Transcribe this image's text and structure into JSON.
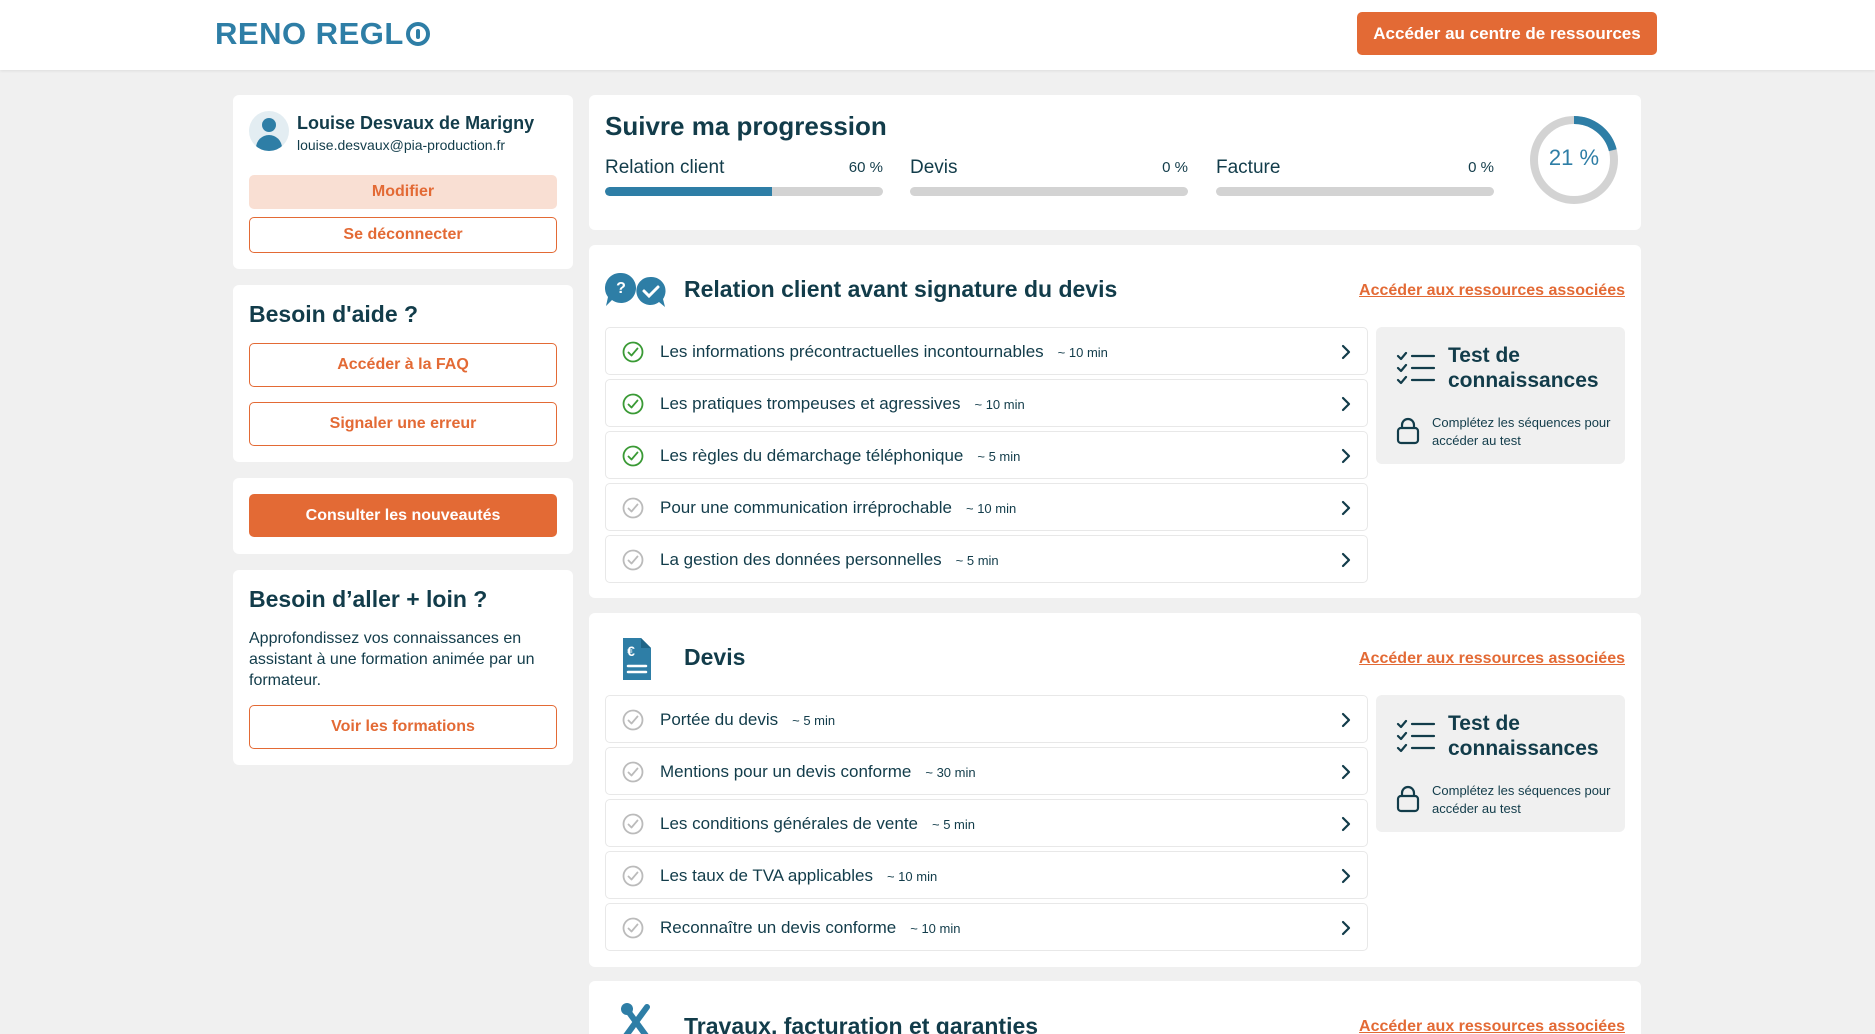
{
  "header": {
    "logo": "RENO REGL",
    "resources_button": "Accéder au centre de ressources"
  },
  "profile": {
    "name": "Louise Desvaux de Marigny",
    "email": "louise.desvaux@pia-production.fr",
    "edit_button": "Modifier",
    "logout_button": "Se déconnecter"
  },
  "help": {
    "title": "Besoin d'aide ?",
    "faq_button": "Accéder à la FAQ",
    "report_button": "Signaler une erreur"
  },
  "news": {
    "button": "Consulter les nouveautés"
  },
  "more": {
    "title": "Besoin d’aller + loin ?",
    "text": "Approfondissez vos connaissances en assistant à une formation animée par un formateur.",
    "button": "Voir les formations"
  },
  "progress": {
    "title": "Suivre ma progression",
    "items": [
      {
        "label": "Relation client",
        "pct_label": "60 %",
        "value": 0.6
      },
      {
        "label": "Devis",
        "pct_label": "0 %",
        "value": 0
      },
      {
        "label": "Facture",
        "pct_label": "0 %",
        "value": 0
      }
    ],
    "overall_label": "21 %",
    "overall_value": 0.21
  },
  "sections": [
    {
      "title": "Relation client avant signature du devis",
      "link": "Accéder aux ressources associées",
      "modules": [
        {
          "title": "Les informations précontractuelles incontournables",
          "duration": "~ 10 min",
          "done": true
        },
        {
          "title": "Les pratiques trompeuses et agressives",
          "duration": "~ 10 min",
          "done": true
        },
        {
          "title": "Les règles du démarchage téléphonique",
          "duration": "~ 5 min",
          "done": true
        },
        {
          "title": "Pour une communication irréprochable",
          "duration": "~ 10 min",
          "done": false
        },
        {
          "title": "La gestion des données personnelles",
          "duration": "~ 5 min",
          "done": false
        }
      ],
      "test_title": "Test de connaissances",
      "test_note": "Complétez les séquences pour accéder au test"
    },
    {
      "title": "Devis",
      "link": "Accéder aux ressources associées",
      "modules": [
        {
          "title": "Portée du devis",
          "duration": "~ 5 min",
          "done": false
        },
        {
          "title": "Mentions pour un devis conforme",
          "duration": "~ 30 min",
          "done": false
        },
        {
          "title": "Les conditions générales de vente",
          "duration": "~ 5 min",
          "done": false
        },
        {
          "title": "Les taux de TVA applicables",
          "duration": "~ 10 min",
          "done": false
        },
        {
          "title": "Reconnaître un devis conforme",
          "duration": "~ 10 min",
          "done": false
        }
      ],
      "test_title": "Test de connaissances",
      "test_note": "Complétez les séquences pour accéder au test"
    },
    {
      "title": "Travaux, facturation et garanties",
      "link": "Accéder aux ressources associées"
    }
  ],
  "colors": {
    "accent": "#e36a35",
    "brand": "#2e7ea6",
    "text": "#123c4a",
    "done": "#3a9a35",
    "pending": "#bbbbbb"
  }
}
